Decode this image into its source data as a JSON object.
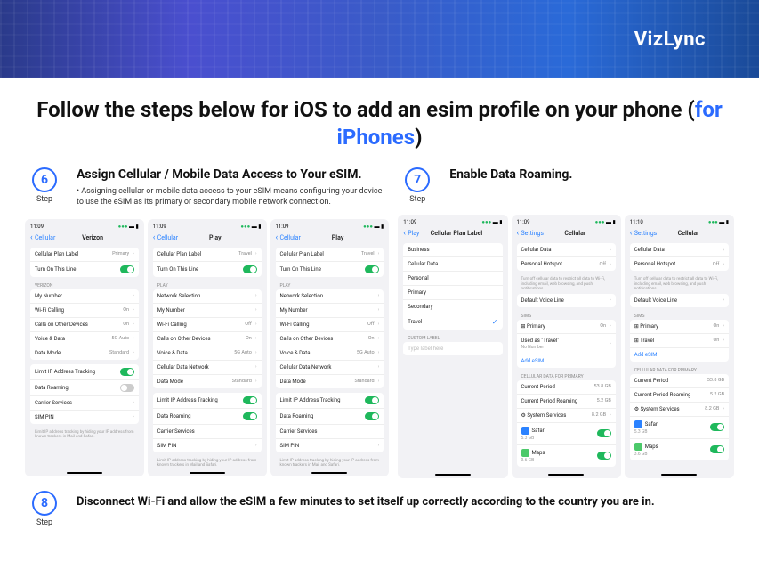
{
  "brand": "VizLync",
  "title": {
    "a": "Follow the steps below for iOS to add an esim profile on your phone (",
    "b": "for iPhones",
    "c": ")"
  },
  "step6": {
    "num": "6",
    "lbl": "Step",
    "title": "Assign Cellular / Mobile Data Access to Your eSIM.",
    "desc": "Assigning cellular or mobile data access to your eSIM means configuring your device to use the eSIM as its primary or secondary mobile network connection.",
    "p1": {
      "time": "11:09",
      "back": "Cellular",
      "title": "Verizon",
      "r": [
        [
          "Cellular Plan Label",
          "Primary",
          1
        ],
        [
          "Turn On This Line",
          "tgon",
          0
        ]
      ],
      "h1": "VERIZON",
      "r2": [
        [
          "My Number",
          "",
          1
        ],
        [
          "Wi-Fi Calling",
          "On",
          1
        ],
        [
          "Calls on Other Devices",
          "On",
          1
        ],
        [
          "Voice & Data",
          "5G Auto",
          1
        ],
        [
          "Data Mode",
          "Standard",
          1
        ]
      ],
      "r3": [
        [
          "Limit IP Address Tracking",
          "tgon",
          0
        ],
        [
          "Data Roaming",
          "tgoff",
          0
        ],
        [
          "Carrier Services",
          "",
          1
        ],
        [
          "SIM PIN",
          "",
          1
        ]
      ],
      "ft": "Limit IP address tracking by hiding your IP address from known trackers in Mail and Safari."
    },
    "p2": {
      "time": "11:09",
      "back": "Cellular",
      "title": "Play",
      "r": [
        [
          "Cellular Plan Label",
          "Travel",
          1
        ],
        [
          "Turn On This Line",
          "tgon",
          0
        ]
      ],
      "h1": "PLAY",
      "r2": [
        [
          "Network Selection",
          "",
          1
        ],
        [
          "My Number",
          "",
          1
        ],
        [
          "Wi-Fi Calling",
          "Off",
          1
        ],
        [
          "Calls on Other Devices",
          "On",
          1
        ],
        [
          "Voice & Data",
          "5G Auto",
          1
        ],
        [
          "Cellular Data Network",
          "",
          1
        ],
        [
          "Data Mode",
          "Standard",
          1
        ]
      ],
      "r3": [
        [
          "Limit IP Address Tracking",
          "tgon",
          0
        ],
        [
          "Data Roaming",
          "tgon",
          0
        ],
        [
          "Carrier Services",
          "",
          0
        ],
        [
          "SIM PIN",
          "",
          1
        ]
      ],
      "ft": "Limit IP address tracking by hiding your IP address from known trackers in Mail and Safari."
    },
    "p3": {
      "time": "11:09",
      "back": "Cellular",
      "title": "Play",
      "r": [
        [
          "Cellular Plan Label",
          "Travel",
          1
        ],
        [
          "Turn On This Line",
          "tgon",
          0
        ]
      ],
      "h1": "PLAY",
      "r2": [
        [
          "Network Selection",
          "",
          1
        ],
        [
          "My Number",
          "",
          1
        ],
        [
          "Wi-Fi Calling",
          "Off",
          1
        ],
        [
          "Calls on Other Devices",
          "On",
          1
        ],
        [
          "Voice & Data",
          "5G Auto",
          1
        ],
        [
          "Cellular Data Network",
          "",
          1
        ],
        [
          "Data Mode",
          "Standard",
          1
        ]
      ],
      "r3": [
        [
          "Limit IP Address Tracking",
          "tgon",
          0
        ],
        [
          "Data Roaming",
          "tgon",
          0
        ],
        [
          "Carrier Services",
          "",
          0
        ],
        [
          "SIM PIN",
          "",
          1
        ]
      ],
      "ft": "Limit IP address tracking by hiding your IP address from known trackers in Mail and Safari."
    }
  },
  "step7": {
    "num": "7",
    "lbl": "Step",
    "title": "Enable Data Roaming.",
    "p1": {
      "time": "11:09",
      "back": "Play",
      "title": "Cellular Plan Label",
      "items": [
        "Business",
        "Cellular Data",
        "Personal",
        "Primary",
        "Secondary"
      ],
      "checked": "Travel",
      "clh": "CUSTOM LABEL",
      "cl": "Type label here"
    },
    "p2": {
      "time": "11:09",
      "back": "Settings",
      "title": "Cellular",
      "r": [
        [
          "Cellular Data",
          "",
          1
        ],
        [
          "Personal Hotspot",
          "Off",
          1
        ]
      ],
      "ft1": "Turn off cellular data to restrict all data to Wi-Fi, including email, web browsing, and push notifications.",
      "r2": [
        [
          "Default Voice Line",
          "",
          1
        ]
      ],
      "h2": "SIMs",
      "r3": [
        [
          "⊞ Primary",
          "On",
          1
        ],
        [
          "Used as \"Travel\"",
          "",
          1
        ],
        [
          "Add eSIM",
          "",
          0
        ]
      ],
      "sub": "No Number",
      "h3": "CELLULAR DATA FOR PRIMARY",
      "r4": [
        [
          "Current Period",
          "53.8 GB",
          0
        ],
        [
          "Current Period Roaming",
          "5.2 GB",
          0
        ],
        [
          "⚙ System Services",
          "8.2 GB",
          1
        ]
      ],
      "apps": [
        [
          "Safari",
          "5.3 GB",
          "#2b82ff"
        ],
        [
          "Maps",
          "3.6 GB",
          "#4cc96a"
        ]
      ]
    },
    "p3": {
      "time": "11:10",
      "back": "Settings",
      "title": "Cellular",
      "r": [
        [
          "Cellular Data",
          "",
          1
        ],
        [
          "Personal Hotspot",
          "Off",
          1
        ]
      ],
      "ft1": "Turn off cellular data to restrict all data to Wi-Fi, including email, web browsing, and push notifications.",
      "r2": [
        [
          "Default Voice Line",
          "",
          1
        ]
      ],
      "h2": "SIMs",
      "r3": [
        [
          "⊞ Primary",
          "On",
          1
        ],
        [
          "⊞ Travel",
          "On",
          1
        ],
        [
          "Add eSIM",
          "",
          0
        ]
      ],
      "h3": "CELLULAR DATA FOR PRIMARY",
      "r4": [
        [
          "Current Period",
          "53.8 GB",
          0
        ],
        [
          "Current Period Roaming",
          "5.2 GB",
          0
        ],
        [
          "⚙ System Services",
          "8.2 GB",
          1
        ]
      ],
      "apps": [
        [
          "Safari",
          "5.3 GB",
          "#2b82ff"
        ],
        [
          "Maps",
          "3.6 GB",
          "#4cc96a"
        ]
      ]
    }
  },
  "step8": {
    "num": "8",
    "lbl": "Step",
    "title": "Disconnect Wi-Fi and allow the eSIM a few minutes to set itself up correctly according to the country you are in."
  }
}
